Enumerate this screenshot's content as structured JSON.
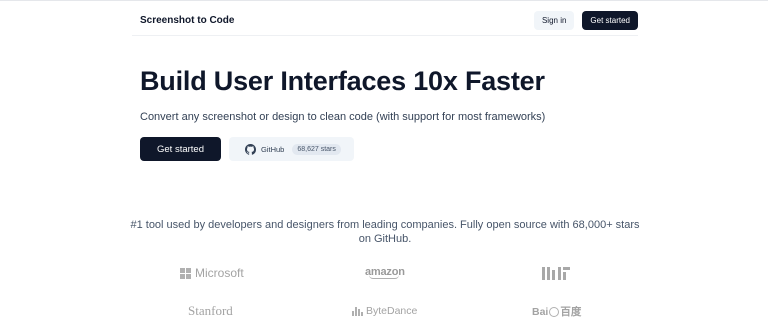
{
  "header": {
    "brand": "Screenshot to Code",
    "sign_in_label": "Sign in",
    "get_started_label": "Get started"
  },
  "hero": {
    "title": "Build User Interfaces 10x Faster",
    "subtitle": "Convert any screenshot or design to clean code (with support for most frameworks)",
    "cta_label": "Get started",
    "github": {
      "icon": "github-icon",
      "label": "GitHub",
      "stars": "68,627 stars"
    }
  },
  "social_proof": {
    "tagline": "#1 tool used by developers and designers from leading companies. Fully open source with 68,000+ stars on GitHub.",
    "logos": {
      "microsoft": "Microsoft",
      "amazon": "amazon",
      "mit": "MIT",
      "stanford": "Stanford",
      "bytedance": "ByteDance",
      "baidu_prefix": "Bai",
      "baidu_suffix": "百度"
    }
  },
  "colors": {
    "primary": "#0f172a",
    "secondary_bg": "#f1f5f9",
    "muted_text": "#475569",
    "logo_gray": "#a3a3a3"
  }
}
